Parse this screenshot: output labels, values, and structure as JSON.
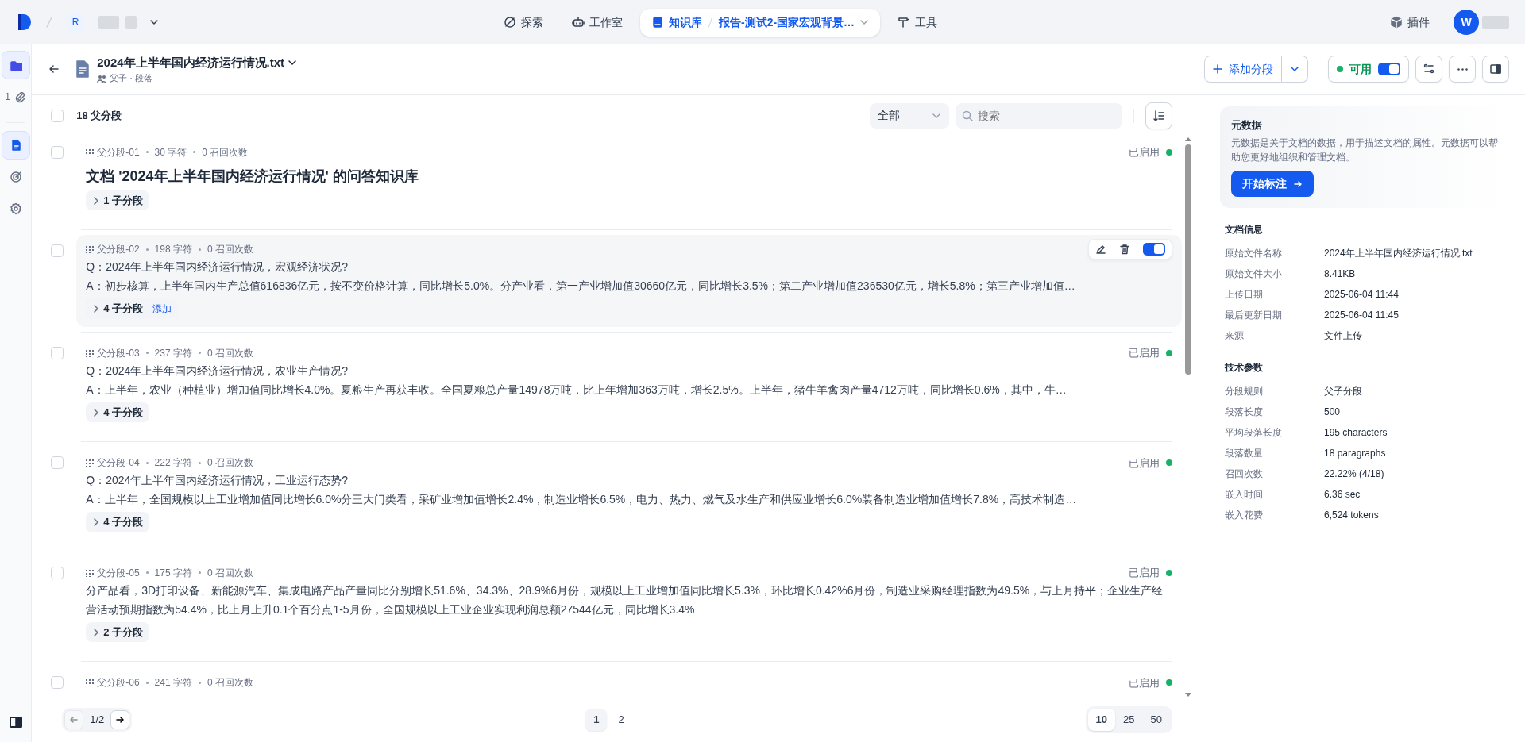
{
  "top_bar": {
    "workspace_initial": "R",
    "nav": [
      {
        "label": "探索",
        "selected": false
      },
      {
        "label": "工作室",
        "selected": false
      },
      {
        "label": "知识库",
        "selected": true,
        "breadcrumb": "报告-测试2-国家宏观背景…"
      },
      {
        "label": "工具",
        "selected": false
      }
    ],
    "plugins": "插件",
    "user_initial": "W"
  },
  "sidebar": {
    "groups": [
      [
        {
          "kind": "folder",
          "selected": true
        },
        {
          "kind": "attachment",
          "count": "1",
          "selected": false
        }
      ],
      [
        {
          "kind": "document",
          "selected": true
        },
        {
          "kind": "target",
          "selected": false
        },
        {
          "kind": "settings",
          "selected": false
        }
      ]
    ]
  },
  "document": {
    "title": "2024年上半年国内经济运行情况.txt",
    "mode": "父子 · 段落",
    "add_button": "添加分段",
    "status": "可用",
    "enabled": true
  },
  "list": {
    "all_checked": false,
    "count": "18 父分段",
    "filter": "全部",
    "search": {
      "placeholder": "搜索"
    },
    "segments": [
      {
        "kind": "heading",
        "checked": false,
        "hovered": false,
        "id_label": "父分段-01",
        "chars": "30 字符",
        "recalls": "0 召回次数",
        "status": "已启用",
        "enabled": true,
        "lines": [
          "文档 '2024年上半年国内经济运行情况' 的问答知识库"
        ],
        "children": "1 子分段"
      },
      {
        "kind": "qa",
        "checked": false,
        "hovered": true,
        "id_label": "父分段-02",
        "chars": "198 字符",
        "recalls": "0 召回次数",
        "enabled": true,
        "lines": [
          "Q：2024年上半年国内经济运行情况，宏观经济状况?",
          "A：初步核算，上半年国内生产总值616836亿元，按不变价格计算，同比增长5.0%。分产业看，第一产业增加值30660亿元，同比增长3.5%；第二产业增加值236530亿元，增长5.8%；第三产业增加值…"
        ],
        "children": "4 子分段",
        "add_link": "添加"
      },
      {
        "kind": "qa",
        "checked": false,
        "hovered": false,
        "id_label": "父分段-03",
        "chars": "237 字符",
        "recalls": "0 召回次数",
        "status": "已启用",
        "enabled": true,
        "lines": [
          "Q：2024年上半年国内经济运行情况，农业生产情况?",
          "A：上半年，农业（种植业）增加值同比增长4.0%。夏粮生产再获丰收。全国夏粮总产量14978万吨，比上年增加363万吨，增长2.5%。上半年，猪牛羊禽肉产量4712万吨，同比增长0.6%，其中，牛…"
        ],
        "children": "4 子分段"
      },
      {
        "kind": "qa",
        "checked": false,
        "hovered": false,
        "id_label": "父分段-04",
        "chars": "222 字符",
        "recalls": "0 召回次数",
        "status": "已启用",
        "enabled": true,
        "lines": [
          "Q：2024年上半年国内经济运行情况，工业运行态势?",
          "A：上半年，全国规模以上工业增加值同比增长6.0%分三大门类看，采矿业增加值增长2.4%，制造业增长6.5%，电力、热力、燃气及水生产和供应业增长6.0%装备制造业增加值增长7.8%，高技术制造…"
        ],
        "children": "4 子分段"
      },
      {
        "kind": "text",
        "checked": false,
        "hovered": false,
        "id_label": "父分段-05",
        "chars": "175 字符",
        "recalls": "0 召回次数",
        "status": "已启用",
        "enabled": true,
        "lines": [
          "分产品看，3D打印设备、新能源汽车、集成电路产品产量同比分别增长51.6%、34.3%、28.9%6月份，规模以上工业增加值同比增长5.3%，环比增长0.42%6月份，制造业采购经理指数为49.5%，与上月持平；企业生产经营活动预期指数为54.4%，比上月上升0.1个百分点1-5月份，全国规模以上工业企业实现利润总额27544亿元，同比增长3.4%"
        ],
        "children": "2 子分段"
      },
      {
        "checked": false,
        "hovered": false,
        "id_label": "父分段-06",
        "chars": "241 字符",
        "recalls": "0 召回次数",
        "status": "已启用",
        "enabled": true
      }
    ]
  },
  "pagination": {
    "current": "1/2",
    "pages": [
      {
        "label": "1",
        "selected": true
      },
      {
        "label": "2",
        "selected": false
      }
    ],
    "sizes": [
      {
        "label": "10",
        "selected": true
      },
      {
        "label": "25",
        "selected": false
      },
      {
        "label": "50",
        "selected": false
      }
    ]
  },
  "metadata": {
    "title": "元数据",
    "description": "元数据是关于文档的数据，用于描述文档的属性。元数据可以帮助您更好地组织和管理文档。",
    "button": "开始标注"
  },
  "sections": [
    {
      "title": "文档信息",
      "rows": [
        {
          "label": "原始文件名称",
          "value": "2024年上半年国内经济运行情况.txt"
        },
        {
          "label": "原始文件大小",
          "value": "8.41KB"
        },
        {
          "label": "上传日期",
          "value": "2025-06-04 11:44"
        },
        {
          "label": "最后更新日期",
          "value": "2025-06-04 11:45"
        },
        {
          "label": "来源",
          "value": "文件上传"
        }
      ]
    },
    {
      "title": "技术参数",
      "rows": [
        {
          "label": "分段规则",
          "value": "父子分段"
        },
        {
          "label": "段落长度",
          "value": "500"
        },
        {
          "label": "平均段落长度",
          "value": "195 characters"
        },
        {
          "label": "段落数量",
          "value": "18 paragraphs"
        },
        {
          "label": "召回次数",
          "value": "22.22% (4/18)"
        },
        {
          "label": "嵌入时间",
          "value": "6.36 sec"
        },
        {
          "label": "嵌入花费",
          "value": "6,524 tokens"
        }
      ]
    }
  ]
}
